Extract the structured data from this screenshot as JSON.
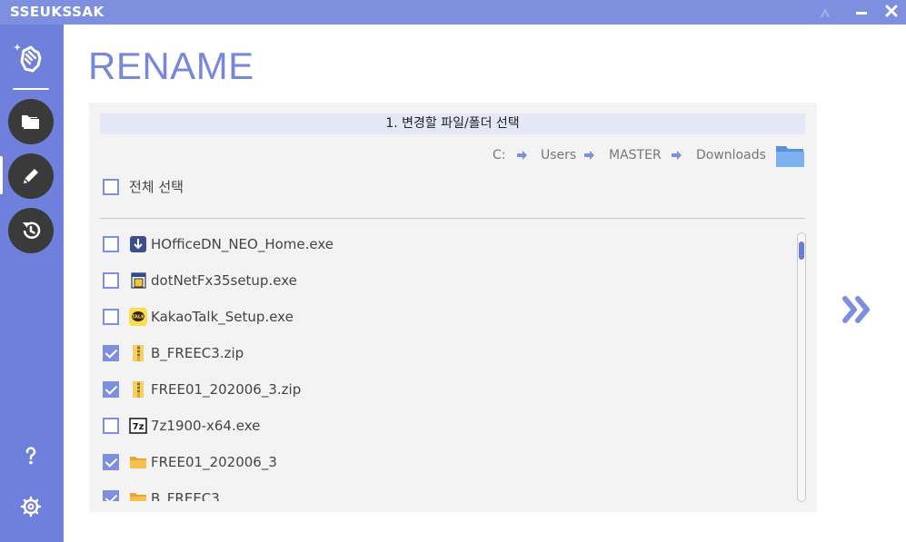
{
  "app": {
    "title": "SSEUKSSAK",
    "accent_color": "#7f8fe0",
    "sidebar_color": "#6f80dc"
  },
  "titlebar": {
    "controls": [
      {
        "name": "drive-icon"
      },
      {
        "name": "minimize",
        "label": "—"
      },
      {
        "name": "close",
        "label": "✕"
      }
    ]
  },
  "sidebar": {
    "logo_icon": "magic-hand-icon",
    "items": [
      {
        "name": "folder",
        "icon": "folder-icon",
        "active": false
      },
      {
        "name": "rename",
        "icon": "pencil-icon",
        "active": true
      },
      {
        "name": "history",
        "icon": "history-icon",
        "active": false
      }
    ],
    "bottom": [
      {
        "name": "help",
        "icon": "help-icon"
      },
      {
        "name": "settings",
        "icon": "gear-icon"
      }
    ]
  },
  "page": {
    "title": "RENAME"
  },
  "panel": {
    "header": "1. 변경할 파일/폴더 선택",
    "path": [
      "C:",
      "Users",
      "MASTER",
      "Downloads"
    ],
    "select_all_label": "전체 선택",
    "files": [
      {
        "name": "HOfficeDN_NEO_Home.exe",
        "checked": false,
        "icon": "download-app-icon"
      },
      {
        "name": "dotNetFx35setup.exe",
        "checked": false,
        "icon": "installer-icon"
      },
      {
        "name": "KakaoTalk_Setup.exe",
        "checked": false,
        "icon": "kakaotalk-icon"
      },
      {
        "name": "B_FREEC3.zip",
        "checked": true,
        "icon": "zip-icon"
      },
      {
        "name": "FREE01_202006_3.zip",
        "checked": true,
        "icon": "zip-icon"
      },
      {
        "name": "7z1900-x64.exe",
        "checked": false,
        "icon": "7zip-icon"
      },
      {
        "name": "FREE01_202006_3",
        "checked": true,
        "icon": "folder-icon"
      },
      {
        "name": "B_FREEC3",
        "checked": true,
        "icon": "folder-icon"
      }
    ],
    "scroll_position": 0.0
  },
  "next_button": {
    "icon": "double-chevron-right-icon"
  }
}
